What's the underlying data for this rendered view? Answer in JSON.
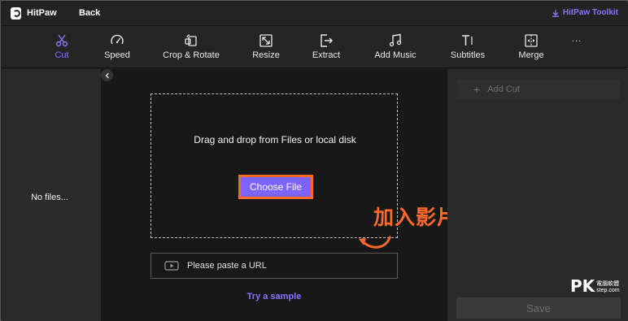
{
  "titlebar": {
    "app_name": "HitPaw",
    "back_label": "Back",
    "toolkit_label": "HitPaw Toolkit"
  },
  "toolbar": {
    "tools": [
      {
        "label": "Cut",
        "icon": "scissors-icon",
        "active": true
      },
      {
        "label": "Speed",
        "icon": "speedometer-icon",
        "active": false
      },
      {
        "label": "Crop & Rotate",
        "icon": "crop-rotate-icon",
        "active": false
      },
      {
        "label": "Resize",
        "icon": "resize-icon",
        "active": false
      },
      {
        "label": "Extract",
        "icon": "extract-icon",
        "active": false
      },
      {
        "label": "Add Music",
        "icon": "music-icon",
        "active": false
      },
      {
        "label": "Subtitles",
        "icon": "subtitles-icon",
        "active": false
      },
      {
        "label": "Merge",
        "icon": "merge-icon",
        "active": false
      }
    ],
    "more_label": "..."
  },
  "left_panel": {
    "empty_text": "No files..."
  },
  "dropzone": {
    "instruction": "Drag and drop from Files or local disk",
    "choose_label": "Choose File",
    "annotation": "加入影片"
  },
  "url_input": {
    "placeholder": "Please paste a URL",
    "icon": "video-play-icon"
  },
  "sample_link": "Try a sample",
  "right_panel": {
    "add_cut_label": "Add Cut",
    "save_label": "Save"
  },
  "watermark": {
    "pk": "PK",
    "line1": "電腦軟體",
    "line2": "step.com"
  },
  "colors": {
    "accent": "#8a74ff",
    "annotation": "#ff6a2c",
    "button": "#7d63ff"
  }
}
